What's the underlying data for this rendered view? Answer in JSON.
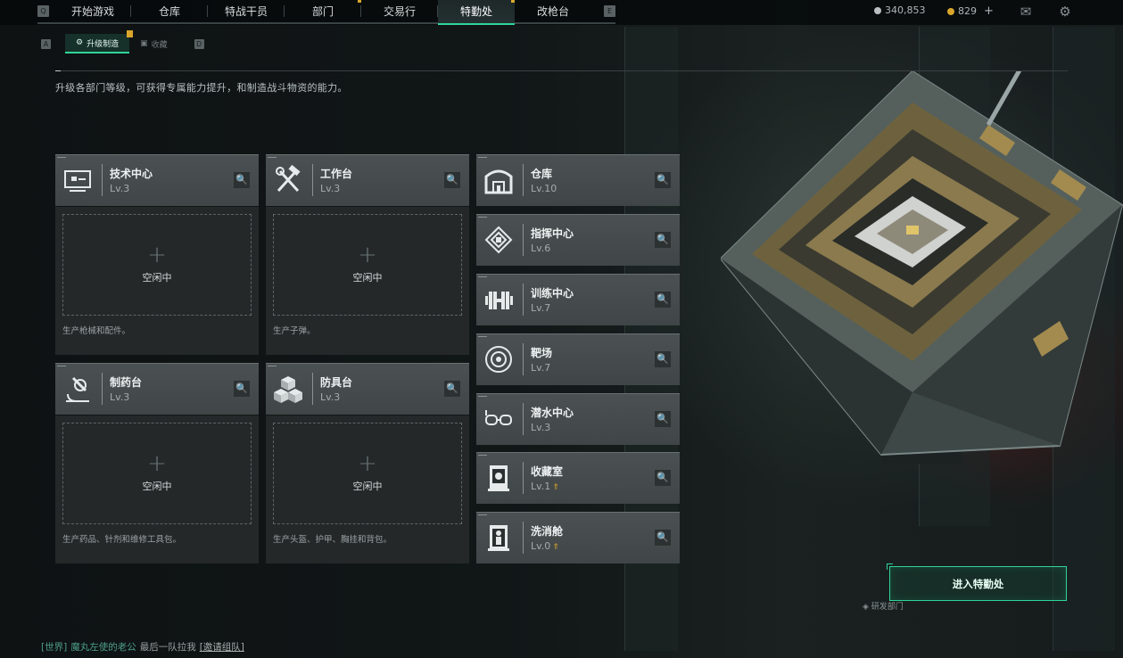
{
  "nav": {
    "left_key": "Q",
    "right_key": "E",
    "tabs": [
      {
        "label": "开始游戏",
        "notify": false,
        "active": false
      },
      {
        "label": "仓库",
        "notify": false,
        "active": false
      },
      {
        "label": "特战干员",
        "notify": false,
        "active": false
      },
      {
        "label": "部门",
        "notify": true,
        "active": false
      },
      {
        "label": "交易行",
        "notify": false,
        "active": false
      },
      {
        "label": "特勤处",
        "notify": true,
        "active": true
      },
      {
        "label": "改枪台",
        "notify": false,
        "active": false
      }
    ]
  },
  "currency": {
    "coins": "340,853",
    "tokens": "829",
    "add_label": "+"
  },
  "subnav": {
    "left_key": "A",
    "right_key": "D",
    "tabs": [
      {
        "label": "升级制造",
        "active": true
      },
      {
        "label": "收藏",
        "active": false
      }
    ]
  },
  "description": "升级各部门等级，可获得专属能力提升，和制造战斗物资的能力。",
  "production": [
    {
      "name": "技术中心",
      "level": "Lv.3",
      "icon": "computer-icon",
      "status": "空闲中",
      "desc": "生产枪械和配件。"
    },
    {
      "name": "工作台",
      "level": "Lv.3",
      "icon": "tools-icon",
      "status": "空闲中",
      "desc": "生产子弹。"
    },
    {
      "name": "制药台",
      "level": "Lv.3",
      "icon": "microscope-icon",
      "status": "空闲中",
      "desc": "生产药品、针剂和维修工具包。"
    },
    {
      "name": "防具台",
      "level": "Lv.3",
      "icon": "cubes-icon",
      "status": "空闲中",
      "desc": "生产头盔、护甲、胸挂和背包。"
    }
  ],
  "departments": [
    {
      "name": "仓库",
      "level": "Lv.10",
      "icon": "warehouse-icon",
      "upgrade": false
    },
    {
      "name": "指挥中心",
      "level": "Lv.6",
      "icon": "chip-icon",
      "upgrade": false
    },
    {
      "name": "训练中心",
      "level": "Lv.7",
      "icon": "dumbbell-icon",
      "upgrade": false
    },
    {
      "name": "靶场",
      "level": "Lv.7",
      "icon": "target-icon",
      "upgrade": false
    },
    {
      "name": "潜水中心",
      "level": "Lv.3",
      "icon": "diving-mask-icon",
      "upgrade": false
    },
    {
      "name": "收藏室",
      "level": "Lv.1",
      "icon": "display-case-icon",
      "upgrade": true
    },
    {
      "name": "洗消舱",
      "level": "Lv.0",
      "icon": "decon-chamber-icon",
      "upgrade": true
    }
  ],
  "enter_button": "进入特勤处",
  "floor_label": "研发部门",
  "chat": {
    "channel": "[世界]",
    "user": "魔丸左使的老公",
    "message": "最后一队拉我",
    "link": "[邀请组队]"
  },
  "colors": {
    "accent": "#2fd59a",
    "notify": "#d9a62b",
    "card": "#474d4e"
  }
}
